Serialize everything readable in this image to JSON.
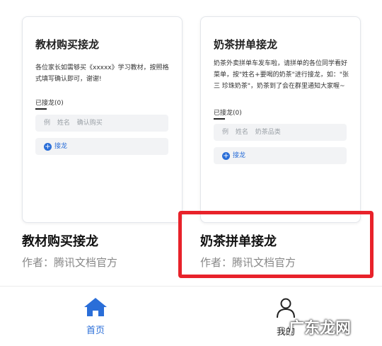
{
  "templates": [
    {
      "card_title": "教材购买接龙",
      "card_desc": "各位家长如需够买《xxxxx》学习教材，按照格式填写确认即可，谢谢!",
      "joined_label": "已接龙(0)",
      "fields": [
        "例",
        "姓名",
        "确认购买"
      ],
      "join_label": "接龙",
      "title": "教材购买接龙",
      "author": "作者：腾讯文档官方"
    },
    {
      "card_title": "奶茶拼单接龙",
      "card_desc": "奶茶外卖拼单车发车啦，请拼单的各位同学看好菜单，按\"姓名+要喝的奶茶\"进行接龙，如：\"张三 珍珠奶茶\"，奶茶到了会在群里通知大家喔~",
      "joined_label": "已接龙(0)",
      "fields": [
        "例",
        "姓名",
        "奶茶品类"
      ],
      "join_label": "接龙",
      "title": "奶茶拼单接龙",
      "author": "作者：腾讯文档官方"
    }
  ],
  "nav": {
    "home_label": "首页",
    "home_icon": "home-icon",
    "mine_label": "我的",
    "mine_icon": "person-icon"
  },
  "watermark": "广东龙网",
  "colors": {
    "accent": "#2a6ed8",
    "highlight": "#e8222a"
  }
}
